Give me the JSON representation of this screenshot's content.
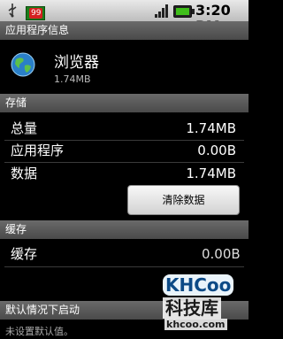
{
  "status_bar": {
    "time": "3:20 PM",
    "notification_count": "99",
    "icons": [
      "usb-icon",
      "market-update-icon",
      "signal-icon",
      "battery-icon"
    ]
  },
  "header": {
    "title": "应用程序信息"
  },
  "app": {
    "name": "浏览器",
    "size": "1.74MB",
    "icon": "browser-globe-icon"
  },
  "storage": {
    "section_title": "存储",
    "rows": [
      {
        "label": "总量",
        "value": "1.74MB"
      },
      {
        "label": "应用程序",
        "value": "0.00B"
      },
      {
        "label": "数据",
        "value": "1.74MB"
      }
    ],
    "clear_button": "清除数据"
  },
  "cache": {
    "section_title": "缓存",
    "label": "缓存",
    "value_partial": "0.00B"
  },
  "defaults": {
    "section_title": "默认情况下启动",
    "text": "未设置默认值。"
  },
  "watermark": {
    "top": "KHCoo",
    "middle": "科技库",
    "bottom": "khcoo.com"
  },
  "colors": {
    "section_header": "#5a5a5a",
    "background": "#000000",
    "battery": "#3fbf1a"
  }
}
